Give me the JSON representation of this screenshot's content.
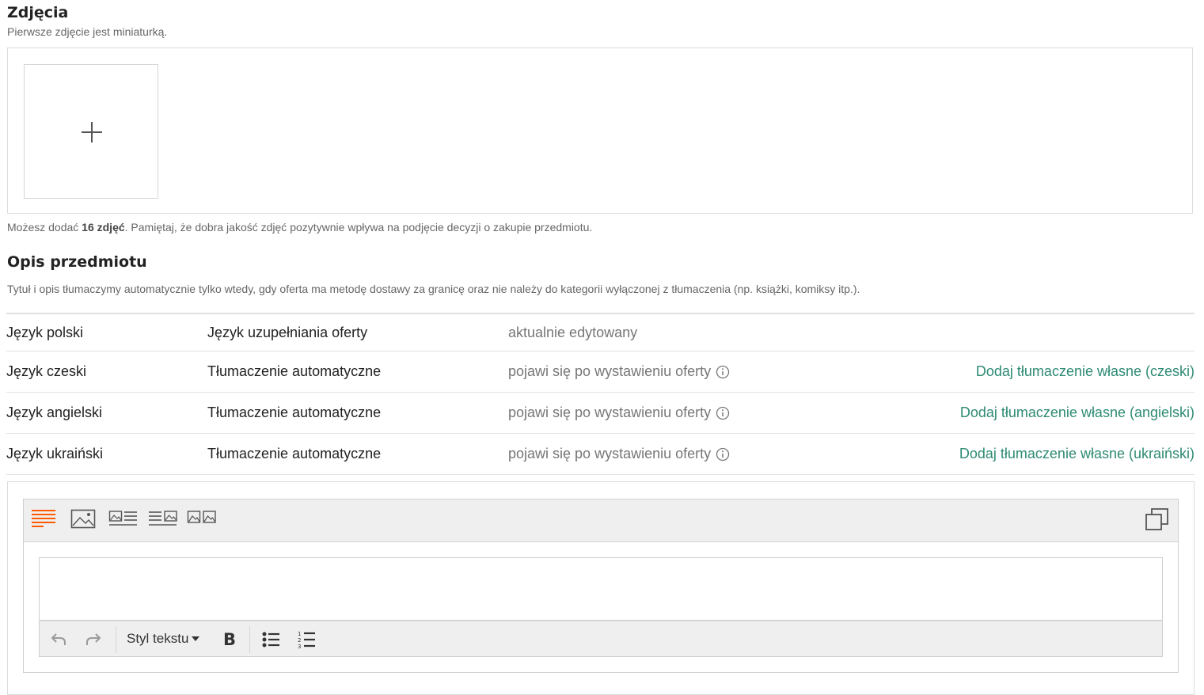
{
  "photos": {
    "title": "Zdjęcia",
    "subtitle": "Pierwsze zdjęcie jest miniaturką.",
    "note_prefix": "Możesz dodać ",
    "note_bold": "16 zdjęć",
    "note_suffix": ". Pamiętaj, że dobra jakość zdjęć pozytywnie wpływa na podjęcie decyzji o zakupie przedmiotu."
  },
  "description": {
    "title": "Opis przedmiotu",
    "subtitle": "Tytuł i opis tłumaczymy automatycznie tylko wtedy, gdy oferta ma metodę dostawy za granicę oraz nie należy do kategorii wyłączonej z tłumaczenia (np. książki, komiksy itp.)."
  },
  "languages": [
    {
      "language": "Język polski",
      "type": "Język uzupełniania oferty",
      "status": "aktualnie edytowany",
      "action": ""
    },
    {
      "language": "Język czeski",
      "type": "Tłumaczenie automatyczne",
      "status": "pojawi się po wystawieniu oferty",
      "action": "Dodaj tłumaczenie własne (czeski)"
    },
    {
      "language": "Język angielski",
      "type": "Tłumaczenie automatyczne",
      "status": "pojawi się po wystawieniu oferty",
      "action": "Dodaj tłumaczenie własne (angielski)"
    },
    {
      "language": "Język ukraiński",
      "type": "Tłumaczenie automatyczne",
      "status": "pojawi się po wystawieniu oferty",
      "action": "Dodaj tłumaczenie własne (ukraiński)"
    }
  ],
  "editor": {
    "style_dropdown": "Styl tekstu",
    "bold_label": "B",
    "accent_color": "#ff5a00",
    "link_color": "#2e8b73"
  }
}
